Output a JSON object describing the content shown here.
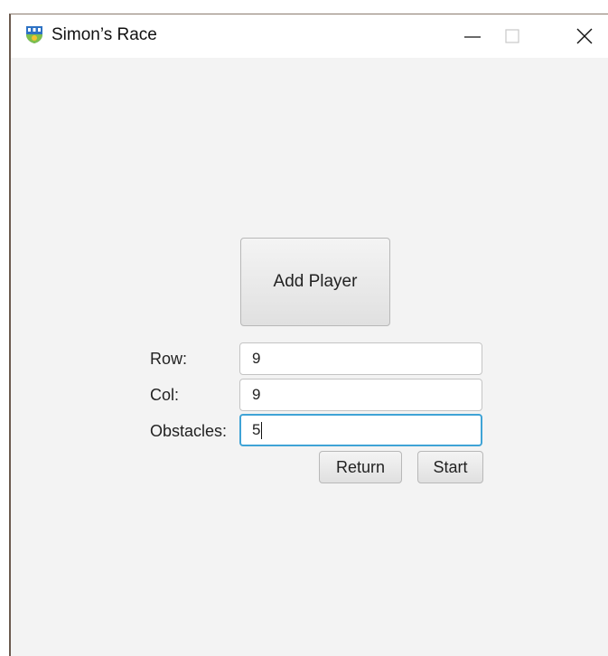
{
  "window": {
    "title": "Simon’s Race",
    "icon": "app-logo-icon",
    "controls": {
      "minimize": "minimize-icon",
      "maximize": "maximize-icon",
      "close": "close-icon"
    }
  },
  "main": {
    "add_player_label": "Add Player",
    "fields": [
      {
        "label": "Row:",
        "value": "9"
      },
      {
        "label": "Col:",
        "value": "9"
      },
      {
        "label": "Obstacles:",
        "value": "5"
      }
    ],
    "return_label": "Return",
    "start_label": "Start"
  },
  "colors": {
    "focus_border": "#3fa3d6",
    "background": "#f3f3f3"
  }
}
